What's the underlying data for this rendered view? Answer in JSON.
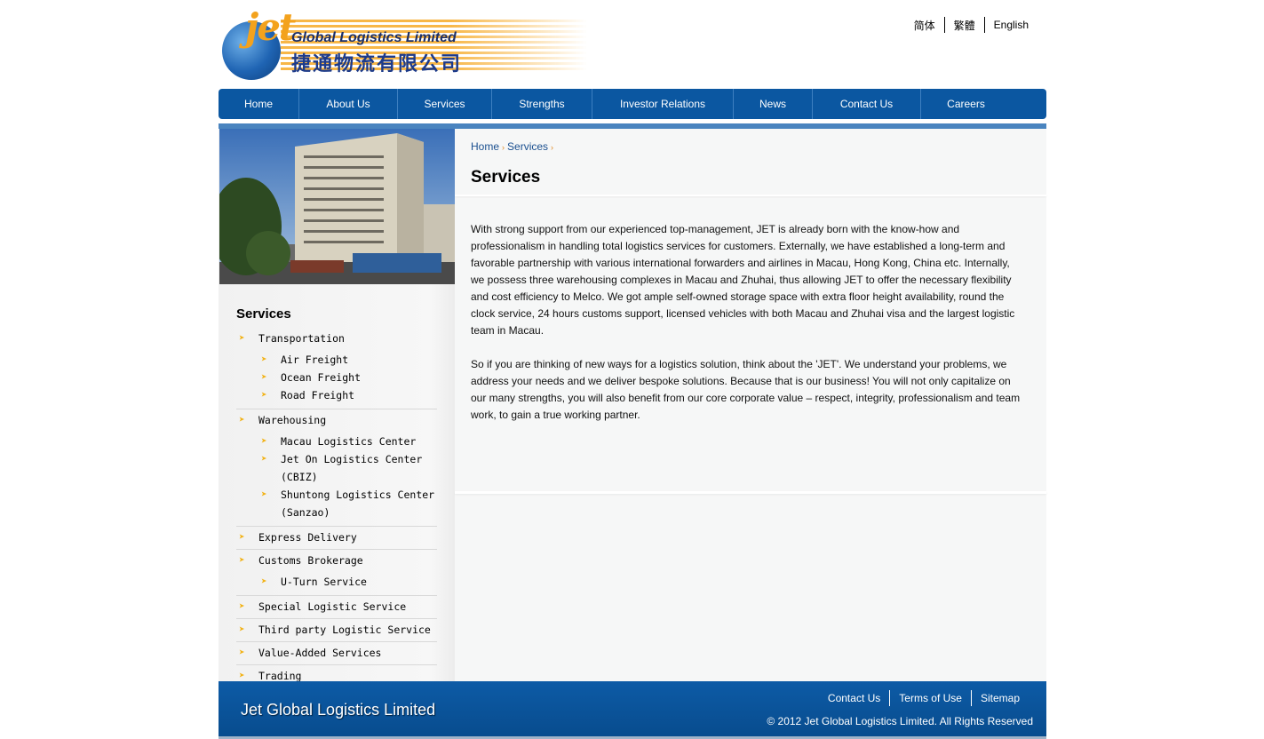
{
  "header": {
    "logo_text_en": "Global Logistics Limited",
    "logo_text_cn": "捷通物流有限公司",
    "logo_mark": "jet",
    "languages": [
      "简体",
      "繁體",
      "English"
    ]
  },
  "nav": {
    "items": [
      "Home",
      "About Us",
      "Services",
      "Strengths",
      "Investor Relations",
      "News",
      "Contact Us",
      "Careers"
    ]
  },
  "breadcrumb": {
    "home": "Home",
    "current": "Services",
    "sep": "›"
  },
  "page_title": "Services",
  "sidebar": {
    "title": "Services",
    "bullet": "➤",
    "groups": [
      {
        "label": "Transportation",
        "children": [
          "Air Freight",
          "Ocean Freight",
          "Road Freight"
        ]
      },
      {
        "label": "Warehousing",
        "children": [
          "Macau Logistics Center",
          "Jet On Logistics Center (CBIZ)",
          "Shuntong Logistics Center (Sanzao)"
        ]
      },
      {
        "label": "Express Delivery",
        "children": []
      },
      {
        "label": "Customs Brokerage",
        "children": [
          "U-Turn Service"
        ]
      },
      {
        "label": "Special Logistic Service",
        "children": []
      },
      {
        "label": "Third party Logistic Service",
        "children": []
      },
      {
        "label": "Value-Added Services",
        "children": []
      },
      {
        "label": "Trading",
        "children": []
      }
    ]
  },
  "content": {
    "paragraphs": [
      "With strong support from our experienced top-management, JET is already born with the know-how and professionalism in handling total logistics services for customers. Externally, we have established a long-term and favorable partnership with various international forwarders and airlines in Macau, Hong Kong, China etc. Internally, we possess three warehousing complexes in Macau and Zhuhai, thus allowing JET to offer the necessary flexibility and cost efficiency to Melco. We got ample self-owned storage space with extra floor height availability, round the clock service, 24 hours customs support, licensed vehicles with both Macau and Zhuhai visa and the largest logistic team in Macau.",
      "So if you are thinking of new ways for a logistics solution, think about the 'JET'. We understand your problems, we address your needs and we deliver bespoke solutions. Because that is our business! You will not only capitalize on our many strengths, you will also benefit from our core corporate value – respect, integrity, professionalism and team work, to gain a true working partner."
    ]
  },
  "footer": {
    "company": "Jet Global Logistics Limited",
    "links": [
      "Contact Us",
      "Terms of Use",
      "Sitemap"
    ],
    "copyright": "© 2012 Jet Global Logistics Limited. All Rights Reserved"
  },
  "colors": {
    "nav_bg": "#0b57a1",
    "accent_orange": "#f3a21d",
    "footer_bg": "#0b57a1"
  }
}
